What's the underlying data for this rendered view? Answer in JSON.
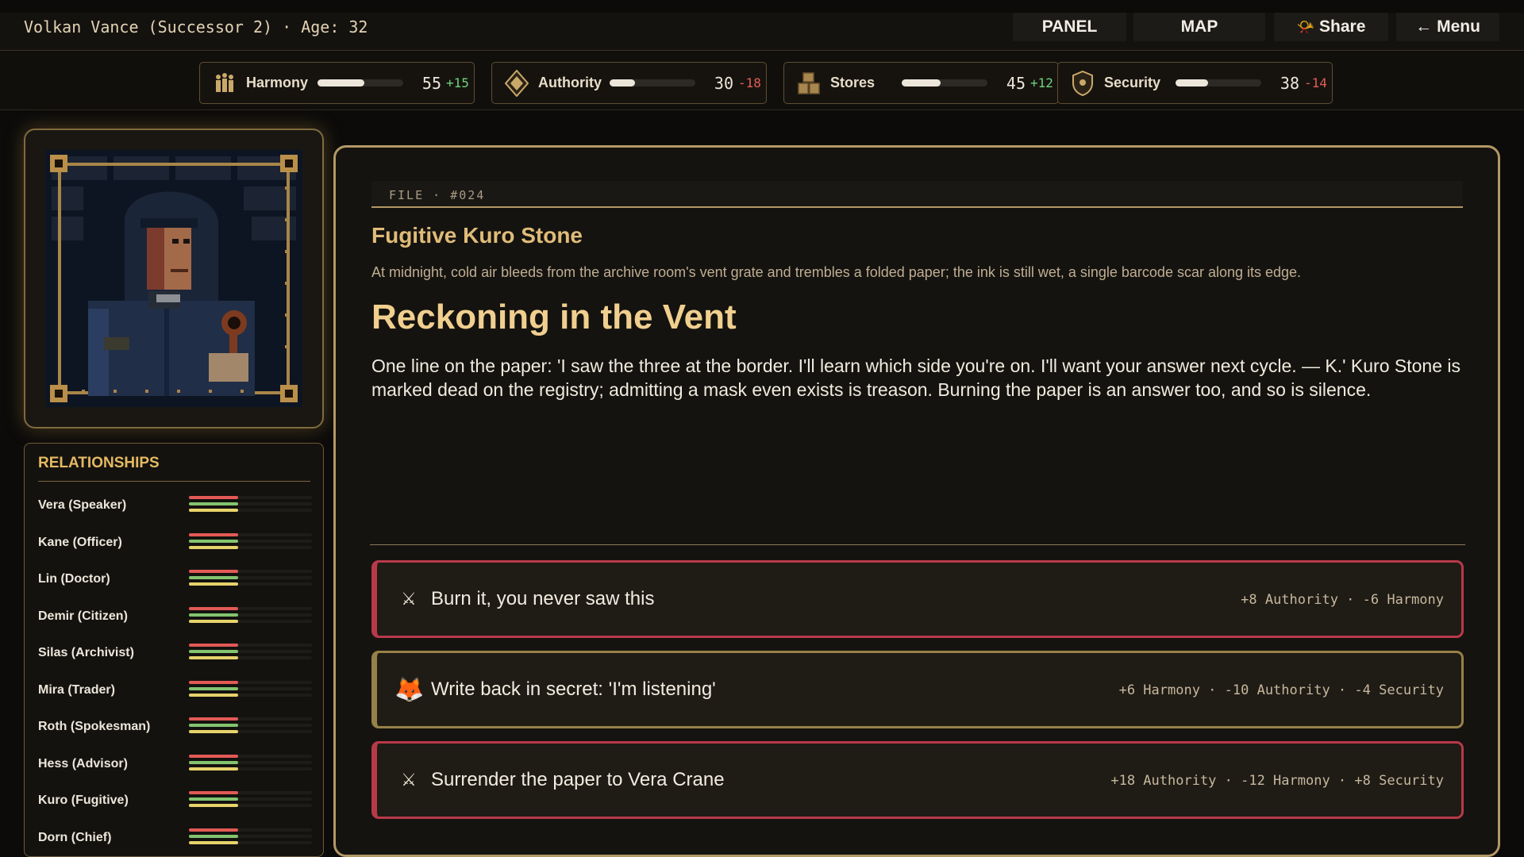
{
  "header": {
    "title": "Volkan Vance (Successor 2) · Age: 32",
    "buttons": [
      {
        "label": "PANEL",
        "icon": ""
      },
      {
        "label": "MAP",
        "icon": ""
      },
      {
        "label": "Share",
        "icon": "📯"
      },
      {
        "label": "Menu",
        "icon": "←"
      }
    ]
  },
  "stats": [
    {
      "label": "Harmony",
      "value": "55",
      "delta": "+15",
      "level": 0.55,
      "icon": "people-icon"
    },
    {
      "label": "Authority",
      "value": "30",
      "delta": "-18",
      "level": 0.3,
      "icon": "diamond-icon"
    },
    {
      "label": "Stores",
      "value": "45",
      "delta": "+12",
      "level": 0.45,
      "icon": "crates-icon"
    },
    {
      "label": "Security",
      "value": "38",
      "delta": "-14",
      "level": 0.38,
      "icon": "shield-icon"
    }
  ],
  "relationships": {
    "title": "RELATIONSHIPS",
    "colors": {
      "red": "#e25a55",
      "green": "#83c46f",
      "yellow": "#e6d36b"
    },
    "items": [
      {
        "name": "Vera (Speaker)",
        "levels": [
          0.4,
          0.4,
          0.4
        ]
      },
      {
        "name": "Kane (Officer)",
        "levels": [
          0.4,
          0.4,
          0.4
        ]
      },
      {
        "name": "Lin (Doctor)",
        "levels": [
          0.4,
          0.4,
          0.4
        ]
      },
      {
        "name": "Demir (Citizen)",
        "levels": [
          0.4,
          0.4,
          0.4
        ]
      },
      {
        "name": "Silas (Archivist)",
        "levels": [
          0.4,
          0.4,
          0.4
        ]
      },
      {
        "name": "Mira (Trader)",
        "levels": [
          0.4,
          0.4,
          0.4
        ]
      },
      {
        "name": "Roth (Spokesman)",
        "levels": [
          0.4,
          0.4,
          0.4
        ]
      },
      {
        "name": "Hess (Advisor)",
        "levels": [
          0.4,
          0.4,
          0.4
        ]
      },
      {
        "name": "Kuro (Fugitive)",
        "levels": [
          0.4,
          0.4,
          0.4
        ]
      },
      {
        "name": "Dorn (Chief)",
        "levels": [
          0.4,
          0.4,
          0.4
        ]
      }
    ]
  },
  "event": {
    "file_label": "FILE · #024",
    "subtitle": "Fugitive Kuro Stone",
    "description": "At midnight, cold air bleeds from the archive room's vent grate and trembles a folded paper; the ink is still wet, a single barcode scar along its edge.",
    "heading": "Reckoning in the Vent",
    "body": "One line on the paper: 'I saw the three at the border. I'll learn which side you're on. I'll want your answer next cycle. — K.' Kuro Stone is marked dead on the registry; admitting a mask even exists is treason. Burning the paper is an answer too, and so is silence."
  },
  "choices": [
    {
      "icon": "⚔",
      "icon_name": "crossed-swords-icon",
      "text": "Burn it, you never saw this",
      "effects": "+8 Authority  ·  -6 Harmony",
      "style": "red"
    },
    {
      "icon": "🦊",
      "icon_name": "fox-icon",
      "text": "Write back in secret: 'I'm listening'",
      "effects": "+6 Harmony  ·  -10 Authority  ·  -4 Security",
      "style": "gold"
    },
    {
      "icon": "⚔",
      "icon_name": "crossed-swords-icon",
      "text": "Surrender the paper to Vera Crane",
      "effects": "+18 Authority  ·  -12 Harmony  ·  +8 Security",
      "style": "red"
    }
  ]
}
